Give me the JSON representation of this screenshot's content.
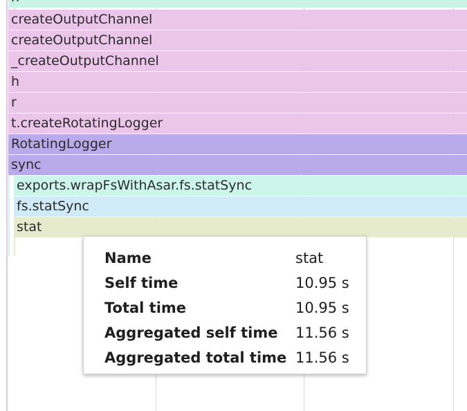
{
  "flame_chart": {
    "frames": [
      {
        "label": "h",
        "color": "#c9f4e6"
      },
      {
        "label": "createOutputChannel",
        "color": "#ecc6ea"
      },
      {
        "label": "createOutputChannel",
        "color": "#ecc6ea"
      },
      {
        "label": "_createOutputChannel",
        "color": "#ecc6ea"
      },
      {
        "label": "h",
        "color": "#ecc6ea"
      },
      {
        "label": "r",
        "color": "#ecc6ea"
      },
      {
        "label": "t.createRotatingLogger",
        "color": "#ecc6ea"
      },
      {
        "label": "RotatingLogger",
        "color": "#b9aaeb"
      },
      {
        "label": "sync",
        "color": "#b9aaeb"
      },
      {
        "label": "exports.wrapFsWithAsar.fs.statSync",
        "color": "#cdf6ea"
      },
      {
        "label": "fs.statSync",
        "color": "#d0ebf7"
      },
      {
        "label": "stat",
        "color": "#e7ebcd"
      }
    ]
  },
  "tooltip": {
    "rows": [
      {
        "label": "Name",
        "value": "stat"
      },
      {
        "label": "Self time",
        "value": "10.95 s"
      },
      {
        "label": "Total time",
        "value": "10.95 s"
      },
      {
        "label": "Aggregated self time",
        "value": "11.56 s"
      },
      {
        "label": "Aggregated total time",
        "value": "11.56 s"
      }
    ]
  }
}
